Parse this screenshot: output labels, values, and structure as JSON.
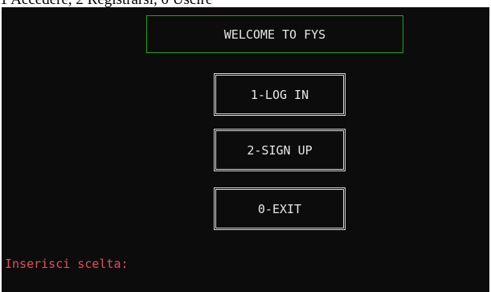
{
  "caption": "1 Accedere, 2 Registrarsi, 0 Uscire",
  "console": {
    "title": "WELCOME TO FYS",
    "menu": [
      {
        "label": "1-LOG IN"
      },
      {
        "label": "2-SIGN UP"
      },
      {
        "label": "0-EXIT"
      }
    ],
    "prompt": "Inserisci scelta:"
  },
  "colors": {
    "background": "#0c0c0c",
    "title_border": "#1fa31f",
    "text": "#e6e6e6",
    "prompt": "#e0505a"
  }
}
